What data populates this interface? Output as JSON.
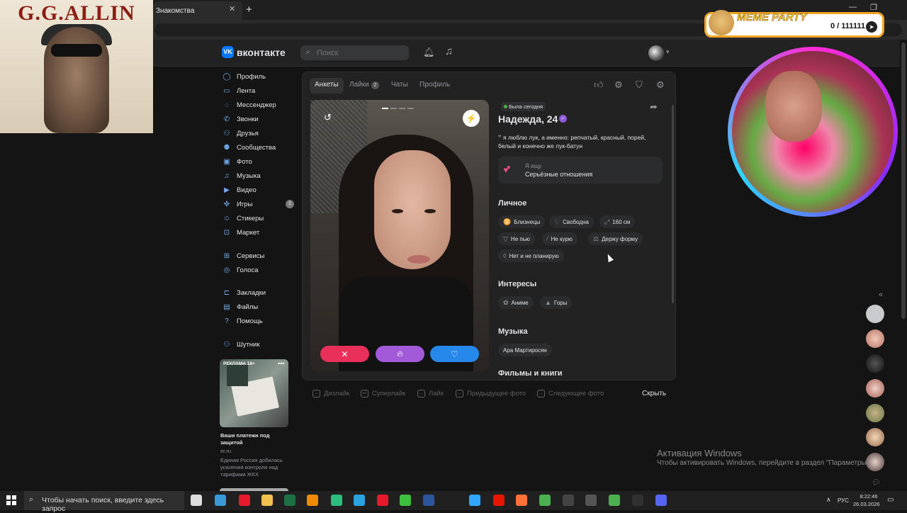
{
  "browser": {
    "tab_title": "Знакомства",
    "tab_close": "✕",
    "new_tab": "+"
  },
  "overlay": {
    "left_title": "G.G.ALLIN",
    "meme_title": "MEME PARTY",
    "meme_score": "0 / 111111"
  },
  "header": {
    "logo_mark": "VK",
    "logo_text": "вконтакте",
    "search_placeholder": "Поиск"
  },
  "sidebar": {
    "items": [
      {
        "label": "Профиль",
        "icon": "user-circle-icon",
        "glyph": "◯"
      },
      {
        "label": "Лента",
        "icon": "feed-icon",
        "glyph": "▭"
      },
      {
        "label": "Мессенджер",
        "icon": "message-icon",
        "glyph": "◌"
      },
      {
        "label": "Звонки",
        "icon": "phone-icon",
        "glyph": "✆"
      },
      {
        "label": "Друзья",
        "icon": "friends-icon",
        "glyph": "⚇"
      },
      {
        "label": "Сообщества",
        "icon": "communities-icon",
        "glyph": "⚉"
      },
      {
        "label": "Фото",
        "icon": "photo-icon",
        "glyph": "▣"
      },
      {
        "label": "Музыка",
        "icon": "music-icon",
        "glyph": "♫"
      },
      {
        "label": "Видео",
        "icon": "video-icon",
        "glyph": "▶"
      },
      {
        "label": "Игры",
        "icon": "games-icon",
        "glyph": "✜"
      },
      {
        "label": "Стикеры",
        "icon": "stickers-icon",
        "glyph": "☺"
      },
      {
        "label": "Маркет",
        "icon": "market-icon",
        "glyph": "⊡"
      },
      {
        "label": "Сервисы",
        "icon": "services-icon",
        "glyph": "⊞"
      },
      {
        "label": "Голоса",
        "icon": "votes-icon",
        "glyph": "◎"
      },
      {
        "label": "Закладки",
        "icon": "bookmark-icon",
        "glyph": "⊏"
      },
      {
        "label": "Файлы",
        "icon": "files-icon",
        "glyph": "▤"
      },
      {
        "label": "Помощь",
        "icon": "help-icon",
        "glyph": "?"
      },
      {
        "label": "Шутник",
        "icon": "joker-icon",
        "glyph": "⚇"
      }
    ],
    "games_badge": "1",
    "ad": {
      "label": "РЕКЛАМА 18+",
      "title": "Ваши платежи под защитой",
      "domain": "er.ru",
      "desc": "Единая Россия добилась усиления контроля над тарифами ЖКХ"
    }
  },
  "dating": {
    "tabs": [
      "Анкеты",
      "Лайки",
      "Чаты",
      "Профиль"
    ],
    "likes_count": "2",
    "online": "Была сегодня",
    "name": "Надежда, 24",
    "bio": "я люблю лук, а именно: репчатый, красный, порей, белый и конечно же лук-батун",
    "seeking_label": "Я ищу",
    "seeking_value": "Серьёзные отношения",
    "personal_title": "Личное",
    "personal": [
      {
        "label": "Близнецы",
        "glyph": "♊"
      },
      {
        "label": "Свободна",
        "glyph": "♡"
      },
      {
        "label": "160 см",
        "glyph": "⤢"
      },
      {
        "label": "Не пью",
        "glyph": "▽"
      },
      {
        "label": "Не курю",
        "glyph": "⁄"
      },
      {
        "label": "Держу форму",
        "glyph": "⚖"
      },
      {
        "label": "Нет и не планирую",
        "glyph": "◊"
      }
    ],
    "interests_title": "Интересы",
    "interests": [
      {
        "label": "Аниме",
        "glyph": "✿"
      },
      {
        "label": "Горы",
        "glyph": "▲"
      }
    ],
    "music_title": "Музыка",
    "music": [
      {
        "label": "Ара Мартиросян"
      }
    ],
    "films_title": "Фильмы и книги"
  },
  "hints": {
    "items": [
      {
        "key": "←",
        "label": "Дизлайк"
      },
      {
        "key": "↵",
        "label": "Суперлайк"
      },
      {
        "key": "→",
        "label": "Лайк"
      },
      {
        "key": "←",
        "label": "Предыдущее фото"
      },
      {
        "key": "→",
        "label": "Следующее фото"
      }
    ],
    "hide": "Скрыть"
  },
  "windows": {
    "activation_title": "Активация Windows",
    "activation_text": "Чтобы активировать Windows, перейдите в раздел \"Параметры\"."
  },
  "taskbar": {
    "search": "Чтобы начать поиск, введите здесь запрос",
    "lang": "РУС",
    "time": "8:22:46",
    "date": "26.03.2026"
  },
  "colors": {
    "vk_blue": "#0077ff",
    "dislike": "#e8305a",
    "superlike": "#a35ad8",
    "like": "#2688eb"
  }
}
